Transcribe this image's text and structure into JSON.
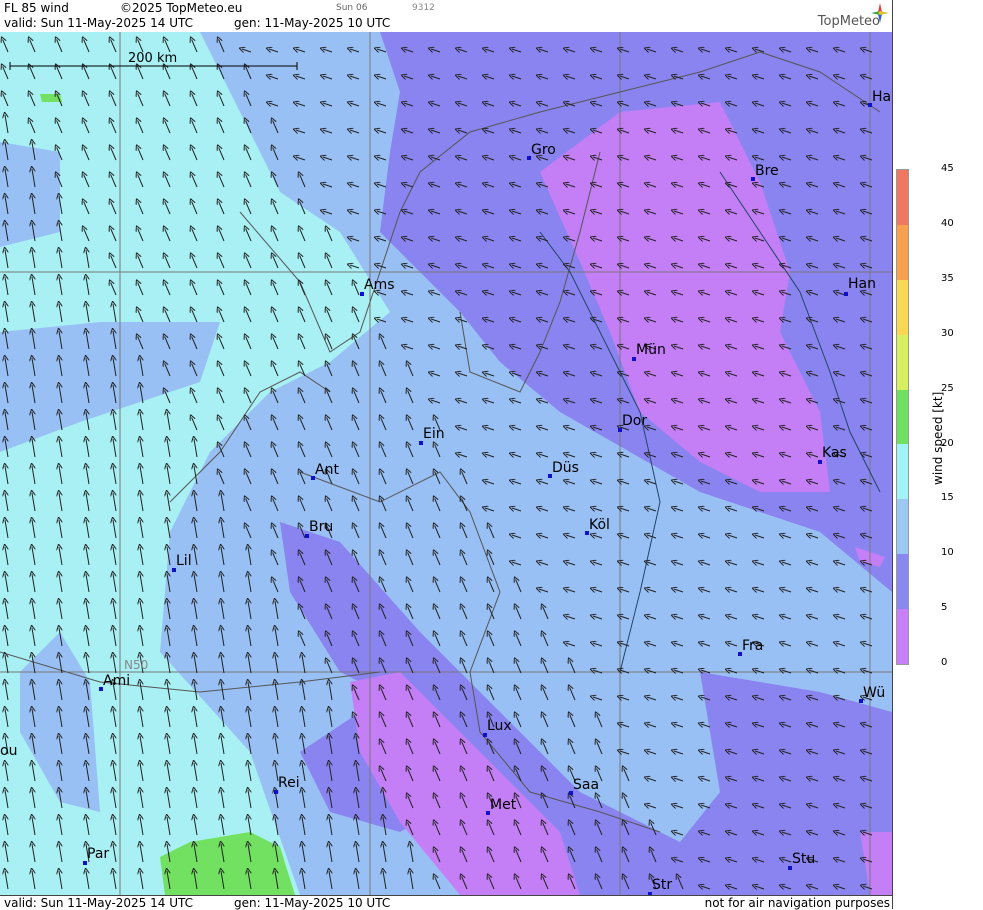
{
  "header": {
    "product": "FL 85 wind",
    "copyright": "©2025 TopMeteo.eu",
    "small_day": "Sun 06",
    "small_code": "9312",
    "valid": "valid:  Sun  11-May-2025  14 UTC",
    "gen": "gen: 11-May-2025 10 UTC",
    "brand": "TopMeteo"
  },
  "footer": {
    "valid": "valid:  Sun  11-May-2025  14 UTC",
    "gen": "gen: 11-May-2025 10 UTC",
    "disclaimer": "not for air navigation purposes"
  },
  "map": {
    "scale_label": "200 km",
    "lat_label": "N50",
    "cities": [
      {
        "name": "Gro"
      },
      {
        "name": "Bre"
      },
      {
        "name": "Ha"
      },
      {
        "name": "Ams"
      },
      {
        "name": "Han"
      },
      {
        "name": "Mün"
      },
      {
        "name": "Ein"
      },
      {
        "name": "Dor"
      },
      {
        "name": "Ant"
      },
      {
        "name": "Düs"
      },
      {
        "name": "Kas"
      },
      {
        "name": "Bru"
      },
      {
        "name": "Köl"
      },
      {
        "name": "Lil"
      },
      {
        "name": "Fra"
      },
      {
        "name": "Ami"
      },
      {
        "name": "Wü"
      },
      {
        "name": "Lux"
      },
      {
        "name": "Saa"
      },
      {
        "name": "Rei"
      },
      {
        "name": "Met"
      },
      {
        "name": "ou"
      },
      {
        "name": "Par"
      },
      {
        "name": "Stu"
      },
      {
        "name": "Str"
      }
    ]
  },
  "legend": {
    "title": "wind  speed  [kt]",
    "ticks": [
      "45",
      "40",
      "35",
      "30",
      "25",
      "20",
      "15",
      "10",
      "5",
      "0"
    ],
    "colors": [
      "#f07860",
      "#f7a050",
      "#f8d850",
      "#d8f060",
      "#70e060",
      "#a0f4f8",
      "#9cc8f4",
      "#8888f0",
      "#c880f8"
    ]
  },
  "palette": {
    "cyan": "#a8f0f4",
    "light_blue": "#98c0f4",
    "blue": "#8a84f0",
    "violet": "#c47ef6",
    "green": "#72e060"
  }
}
